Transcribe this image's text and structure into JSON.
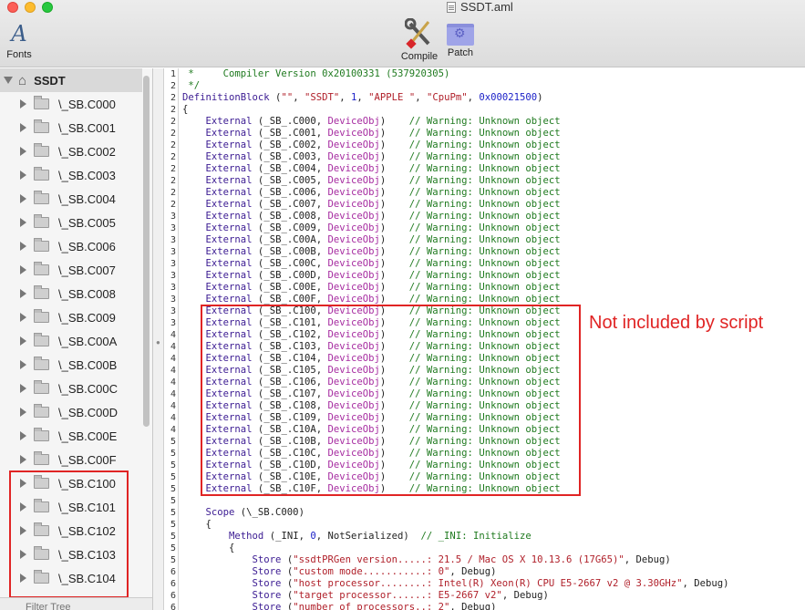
{
  "window": {
    "title": "SSDT.aml"
  },
  "toolbar": {
    "fonts_label": "Fonts",
    "compile_label": "Compile",
    "patch_label": "Patch",
    "fonts_icon": "A"
  },
  "sidebar": {
    "root_label": "SSDT",
    "items": [
      "\\_SB.C000",
      "\\_SB.C001",
      "\\_SB.C002",
      "\\_SB.C003",
      "\\_SB.C004",
      "\\_SB.C005",
      "\\_SB.C006",
      "\\_SB.C007",
      "\\_SB.C008",
      "\\_SB.C009",
      "\\_SB.C00A",
      "\\_SB.C00B",
      "\\_SB.C00C",
      "\\_SB.C00D",
      "\\_SB.C00E",
      "\\_SB.C00F",
      "\\_SB.C100",
      "\\_SB.C101",
      "\\_SB.C102",
      "\\_SB.C103",
      "\\_SB.C104"
    ],
    "filter_placeholder": "Filter Tree"
  },
  "gutter": [
    "1",
    "2",
    "2",
    "2",
    "2",
    "2",
    "2",
    "2",
    "2",
    "2",
    "2",
    "2",
    "3",
    "3",
    "3",
    "3",
    "3",
    "3",
    "3",
    "3",
    "3",
    "3",
    "4",
    "4",
    "4",
    "4",
    "4",
    "4",
    "4",
    "4",
    "4",
    "5",
    "5",
    "5",
    "5",
    "5",
    "5",
    "5",
    "5",
    "5",
    "5",
    "5",
    "6",
    "6",
    "6",
    "6",
    "6"
  ],
  "code": {
    "comment_compiler": " *     Compiler Version 0x20100331 (537920305)",
    "comment_end": " */",
    "defblock_kw": "DefinitionBlock",
    "defblock_open": " (",
    "defblock_a": "\"\"",
    "defblock_sep1": ", ",
    "defblock_b": "\"SSDT\"",
    "defblock_sep2": ", ",
    "defblock_c": "1",
    "defblock_sep3": ", ",
    "defblock_d": "\"APPLE \"",
    "defblock_sep4": ", ",
    "defblock_e": "\"CpuPm\"",
    "defblock_sep5": ", ",
    "defblock_f": "0x00021500",
    "defblock_close": ")",
    "brace_open": "{",
    "external_kw": "External",
    "deviceobj": "DeviceObj",
    "warning": "// Warning: Unknown object",
    "externals": [
      "_SB_.C000",
      "_SB_.C001",
      "_SB_.C002",
      "_SB_.C003",
      "_SB_.C004",
      "_SB_.C005",
      "_SB_.C006",
      "_SB_.C007",
      "_SB_.C008",
      "_SB_.C009",
      "_SB_.C00A",
      "_SB_.C00B",
      "_SB_.C00C",
      "_SB_.C00D",
      "_SB_.C00E",
      "_SB_.C00F",
      "_SB_.C100",
      "_SB_.C101",
      "_SB_.C102",
      "_SB_.C103",
      "_SB_.C104",
      "_SB_.C105",
      "_SB_.C106",
      "_SB_.C107",
      "_SB_.C108",
      "_SB_.C109",
      "_SB_.C10A",
      "_SB_.C10B",
      "_SB_.C10C",
      "_SB_.C10D",
      "_SB_.C10E",
      "_SB_.C10F"
    ],
    "scope_kw": "Scope",
    "scope_arg": " (\\_SB.C000)",
    "scope_brace": "{",
    "method_kw": "Method",
    "method_open": " (_INI, ",
    "method_num": "0",
    "method_ser": ", NotSerialized)  ",
    "method_comment": "// _INI: Initialize",
    "method_brace": "{",
    "store_kw": "Store",
    "stores": [
      {
        "str": "\"ssdtPRGen version.....: 21.5 / Mac OS X 10.13.6 (17G65)\"",
        "tail": ", Debug)"
      },
      {
        "str": "\"custom mode...........: 0\"",
        "tail": ", Debug)"
      },
      {
        "str": "\"host processor........: Intel(R) Xeon(R) CPU E5-2667 v2 @ 3.30GHz\"",
        "tail": ", Debug)"
      },
      {
        "str": "\"target processor......: E5-2667 v2\"",
        "tail": ", Debug)"
      },
      {
        "str": "\"number of processors..: 2\"",
        "tail": ", Debug)"
      }
    ]
  },
  "annotation": {
    "text": "Not included by script"
  }
}
